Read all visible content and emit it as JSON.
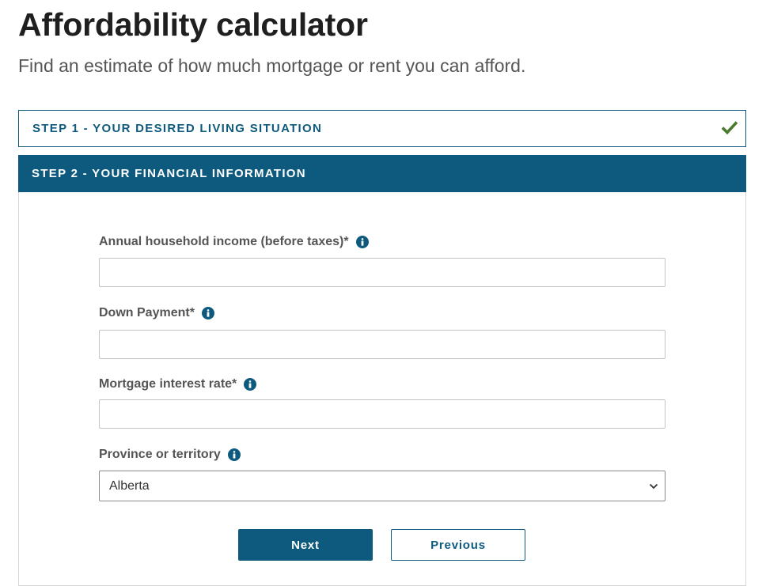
{
  "header": {
    "title": "Affordability calculator",
    "subtitle": "Find an estimate of how much mortgage or rent you can afford."
  },
  "steps": [
    {
      "label": "STEP 1 - YOUR DESIRED LIVING SITUATION",
      "status_icon": "check-icon",
      "completed": true
    },
    {
      "label": "STEP 2 - YOUR FINANCIAL INFORMATION",
      "active": true
    }
  ],
  "form": {
    "income": {
      "label": "Annual household income (before taxes)*",
      "value": "",
      "placeholder": "",
      "icon": "info-icon"
    },
    "down_payment": {
      "label": "Down Payment*",
      "value": "",
      "placeholder": "",
      "icon": "info-icon"
    },
    "interest_rate": {
      "label": "Mortgage interest rate*",
      "value": "",
      "placeholder": "",
      "icon": "info-icon"
    },
    "province": {
      "label": "Province or territory",
      "selected": "Alberta",
      "icon": "info-icon"
    }
  },
  "buttons": {
    "next": "Next",
    "previous": "Previous"
  },
  "colors": {
    "primary": "#0e5a7e",
    "check": "#4a7a2c",
    "label": "#555555"
  }
}
